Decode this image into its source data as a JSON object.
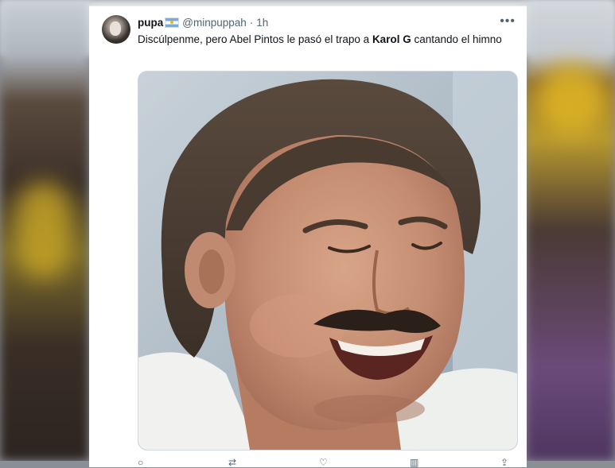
{
  "tweet": {
    "display_name": "pupa",
    "flag_icon": "argentina-flag-icon",
    "handle": "@minpuppah",
    "separator": "·",
    "time": "1h",
    "more_label": "•••",
    "text_before": "Discúlpenme, pero Abel Pintos le pasó el trapo a ",
    "text_bold": "Karol G",
    "text_after": " cantando el himno",
    "media_description_icon": "meme-photo"
  },
  "actions": [
    "reply-icon",
    "retweet-icon",
    "like-icon",
    "views-icon",
    "share-icon"
  ],
  "colors": {
    "text_primary": "#0f1419",
    "text_secondary": "#536471",
    "card_bg": "#ffffff"
  }
}
